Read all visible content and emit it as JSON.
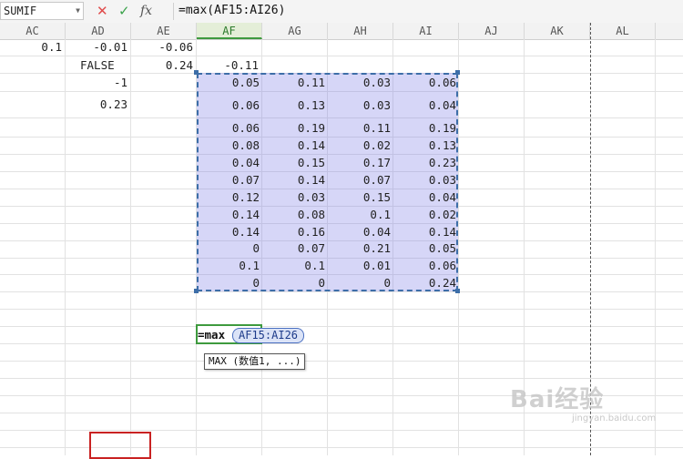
{
  "formula_bar": {
    "name_box": "SUMIF",
    "cancel_icon": "close-icon",
    "confirm_icon": "check-icon",
    "fx_label": "fx",
    "formula": "=max(AF15:AI26)"
  },
  "columns": [
    "AC",
    "AD",
    "AE",
    "AF",
    "AG",
    "AH",
    "AI",
    "AJ",
    "AK",
    "AL"
  ],
  "selected_column": "AF",
  "cells": {
    "row1": {
      "AC": "0.1",
      "AD": "-0.01",
      "AE": "-0.06"
    },
    "row2": {
      "AD": "FALSE",
      "AE": "0.24",
      "AF": "-0.11"
    },
    "row3": {
      "AD": "-1"
    },
    "row4": {
      "AD": "0.23"
    }
  },
  "selection_values": [
    [
      "0.05",
      "0.11",
      "0.03",
      "0.06"
    ],
    [
      "0.06",
      "0.13",
      "0.03",
      "0.04"
    ],
    [
      "0.06",
      "0.19",
      "0.11",
      "0.19"
    ],
    [
      "0.08",
      "0.14",
      "0.02",
      "0.13"
    ],
    [
      "0.04",
      "0.15",
      "0.17",
      "0.23"
    ],
    [
      "0.07",
      "0.14",
      "0.07",
      "0.03"
    ],
    [
      "0.12",
      "0.03",
      "0.15",
      "0.04"
    ],
    [
      "0.14",
      "0.08",
      "0.1",
      "0.02"
    ],
    [
      "0.14",
      "0.16",
      "0.04",
      "0.14"
    ],
    [
      "0",
      "0.07",
      "0.21",
      "0.05"
    ],
    [
      "0.1",
      "0.1",
      "0.01",
      "0.06"
    ],
    [
      "0",
      "0",
      "0",
      "0.24"
    ]
  ],
  "edit_cell": {
    "function": "=max",
    "range": "AF15:AI26",
    "tooltip": "MAX (数值1, ...)"
  },
  "watermark": {
    "text": "Bai经验",
    "sub": "jingyan.baidu.com"
  },
  "colors": {
    "selection_border": "#3d6ea8",
    "active_border": "#3e9a3e",
    "highlight_box": "#c92222"
  }
}
